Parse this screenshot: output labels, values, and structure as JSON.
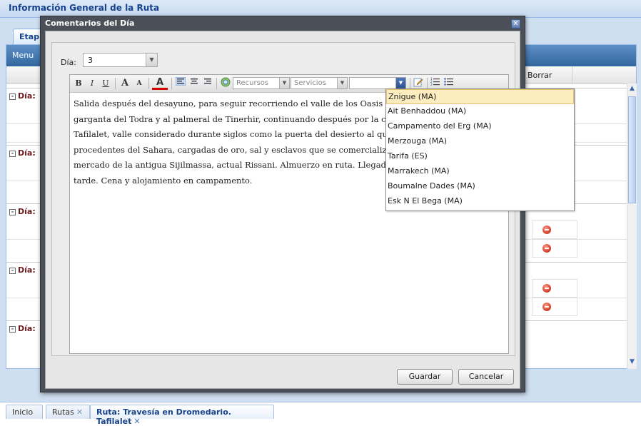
{
  "background": {
    "title": "Información General de la Ruta",
    "tab": "Etap",
    "menu": "Menu",
    "column_borrar": "Borrar",
    "day_label": "Día:"
  },
  "modal": {
    "title": "Comentarios del Día",
    "dia_label": "Día:",
    "dia_value": "3",
    "toolbar": {
      "bold": "B",
      "italic": "I",
      "underline": "U",
      "grow": "A",
      "shrink": "A",
      "color": "A",
      "recursos": "Recursos",
      "servicios": "Servicios"
    },
    "body_text": "Salida después del desayuno, para seguir recorriendo el valle de los Oasis por la garganta del Todra y al palmeral de Tinerhir, continuando después por la c... Tafilalet, valle considerado durante siglos como la puerta del desierto al que llegaban procedentes del Sahara, cargadas de oro, sal y esclavos que se comercializaban en el mercado de la antigua Sijilmassa, actual Rissani. Almuerzo en ruta. Llegada por la tarde. Cena y alojamiento en campamento.",
    "lines": [
      "Salida después del desayuno, para seguir recorriendo el valle de los Oasis p",
      "garganta del Todra y al palmeral de Tinerhir, continuando después por la c",
      "Tafilalet, valle considerado durante siglos como la puerta del desierto al qu",
      "procedentes del Sahara, cargadas de oro, sal y esclavos que se comercializ",
      "mercado de la antigua Sijilmassa, actual Rissani. Almuerzo en ruta. Llegada",
      "tarde. Cena y alojamiento en campamento."
    ],
    "dropdown_options": [
      "Znigue (MA)",
      "Ait Benhaddou (MA)",
      "Campamento del Erg (MA)",
      "Merzouga (MA)",
      "Tarifa (ES)",
      "Marrakech (MA)",
      "Boumalne Dades (MA)",
      "Esk N El Bega (MA)"
    ],
    "save": "Guardar",
    "cancel": "Cancelar"
  },
  "bottom_tabs": [
    "Inicio",
    "Rutas",
    "Ruta: Travesía en Dromedario. Tafilalet"
  ],
  "colors": {
    "accent": "#15428b",
    "modal_frame": "#4b4f57",
    "selected_item": "#fcecbe",
    "day_label": "#6b1b1b",
    "delete": "#d9452f"
  }
}
